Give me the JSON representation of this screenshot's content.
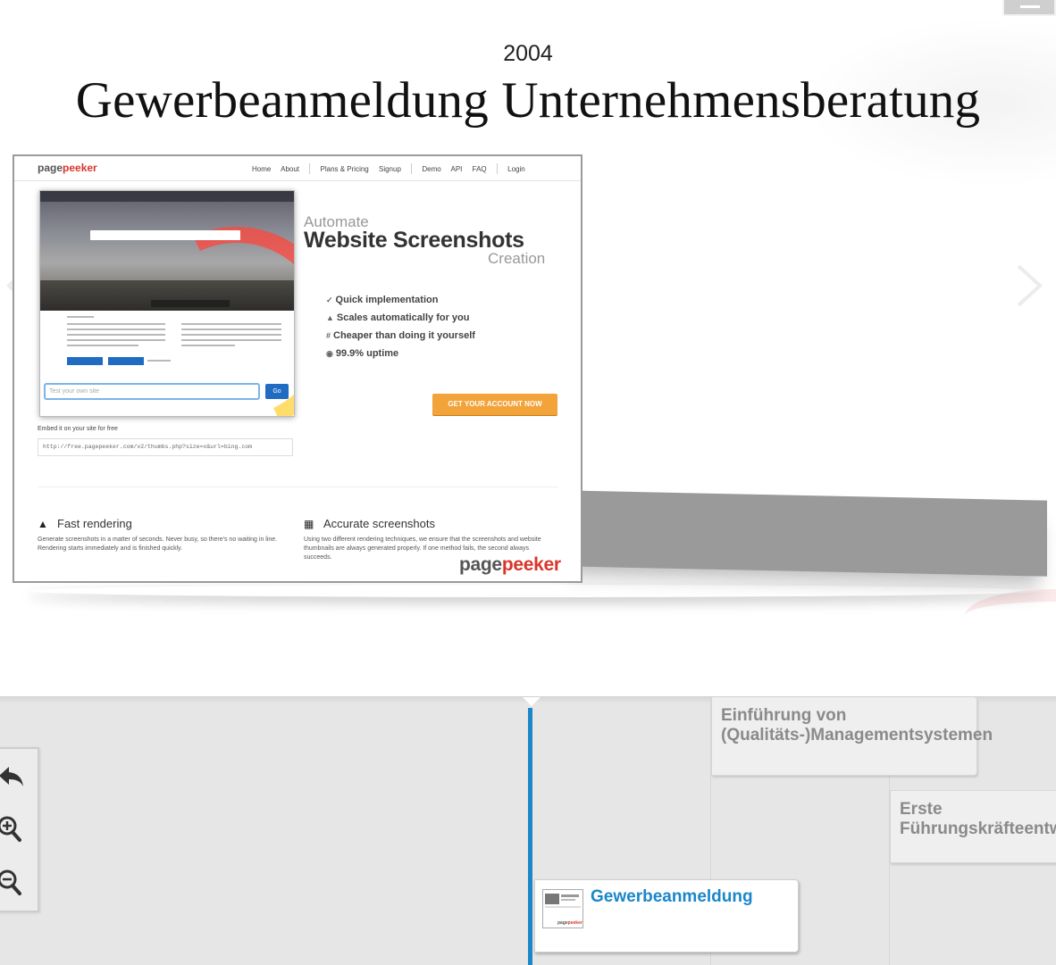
{
  "slide": {
    "year": "2004",
    "title": "Gewerbeanmeldung Unternehmensberatung"
  },
  "screenshot": {
    "logo_plain": "page",
    "logo_accent": "peeker",
    "nav": [
      "Home",
      "About",
      "Plans & Pricing",
      "Signup",
      "Demo",
      "API",
      "FAQ",
      "Login"
    ],
    "test_placeholder": "Test your own site",
    "go_label": "Go",
    "automate": "Automate",
    "website_screenshots": "Website Screenshots",
    "creation": "Creation",
    "features": [
      {
        "icon": "✓",
        "label": "Quick implementation"
      },
      {
        "icon": "▲",
        "label": "Scales automatically for you"
      },
      {
        "icon": "#",
        "label": "Cheaper than doing it yourself"
      },
      {
        "icon": "◉",
        "label": "99.9% uptime"
      }
    ],
    "cta": "GET YOUR ACCOUNT NOW",
    "embed_label": "Embed it on your site for free",
    "embed_code": "http://free.pagepeeker.com/v2/thumbs.php?size=x&url=bing.com",
    "fast_title": "Fast rendering",
    "fast_text": "Generate screenshots in a matter of seconds. Never busy, so there's no waiting in line. Rendering starts immediately and is finished quickly.",
    "accurate_title": "Accurate screenshots",
    "accurate_text": "Using two different rendering techniques, we ensure that the screenshots and website thumbnails are always generated properly. If one method fails, the second always succeeds.",
    "brand_plain": "page",
    "brand_accent": "peeker"
  },
  "timeline": {
    "events": {
      "qms": "Einführung von (Qualitäts-)Managementsystemen",
      "fk": "Erste Führungskräfteentwicklung",
      "gew": "Gewerbeanmeldung"
    },
    "thumb_brand_plain": "page",
    "thumb_brand_accent": "peeker"
  },
  "icons": {
    "prev": "chevron-left-icon",
    "next": "chevron-right-icon",
    "back": "undo-arrow-icon",
    "zoom_in": "zoom-in-icon",
    "zoom_out": "zoom-out-icon"
  },
  "colors": {
    "accent_blue": "#1b86c9",
    "brand_red": "#d9362b",
    "cta_orange": "#f2a33a"
  }
}
